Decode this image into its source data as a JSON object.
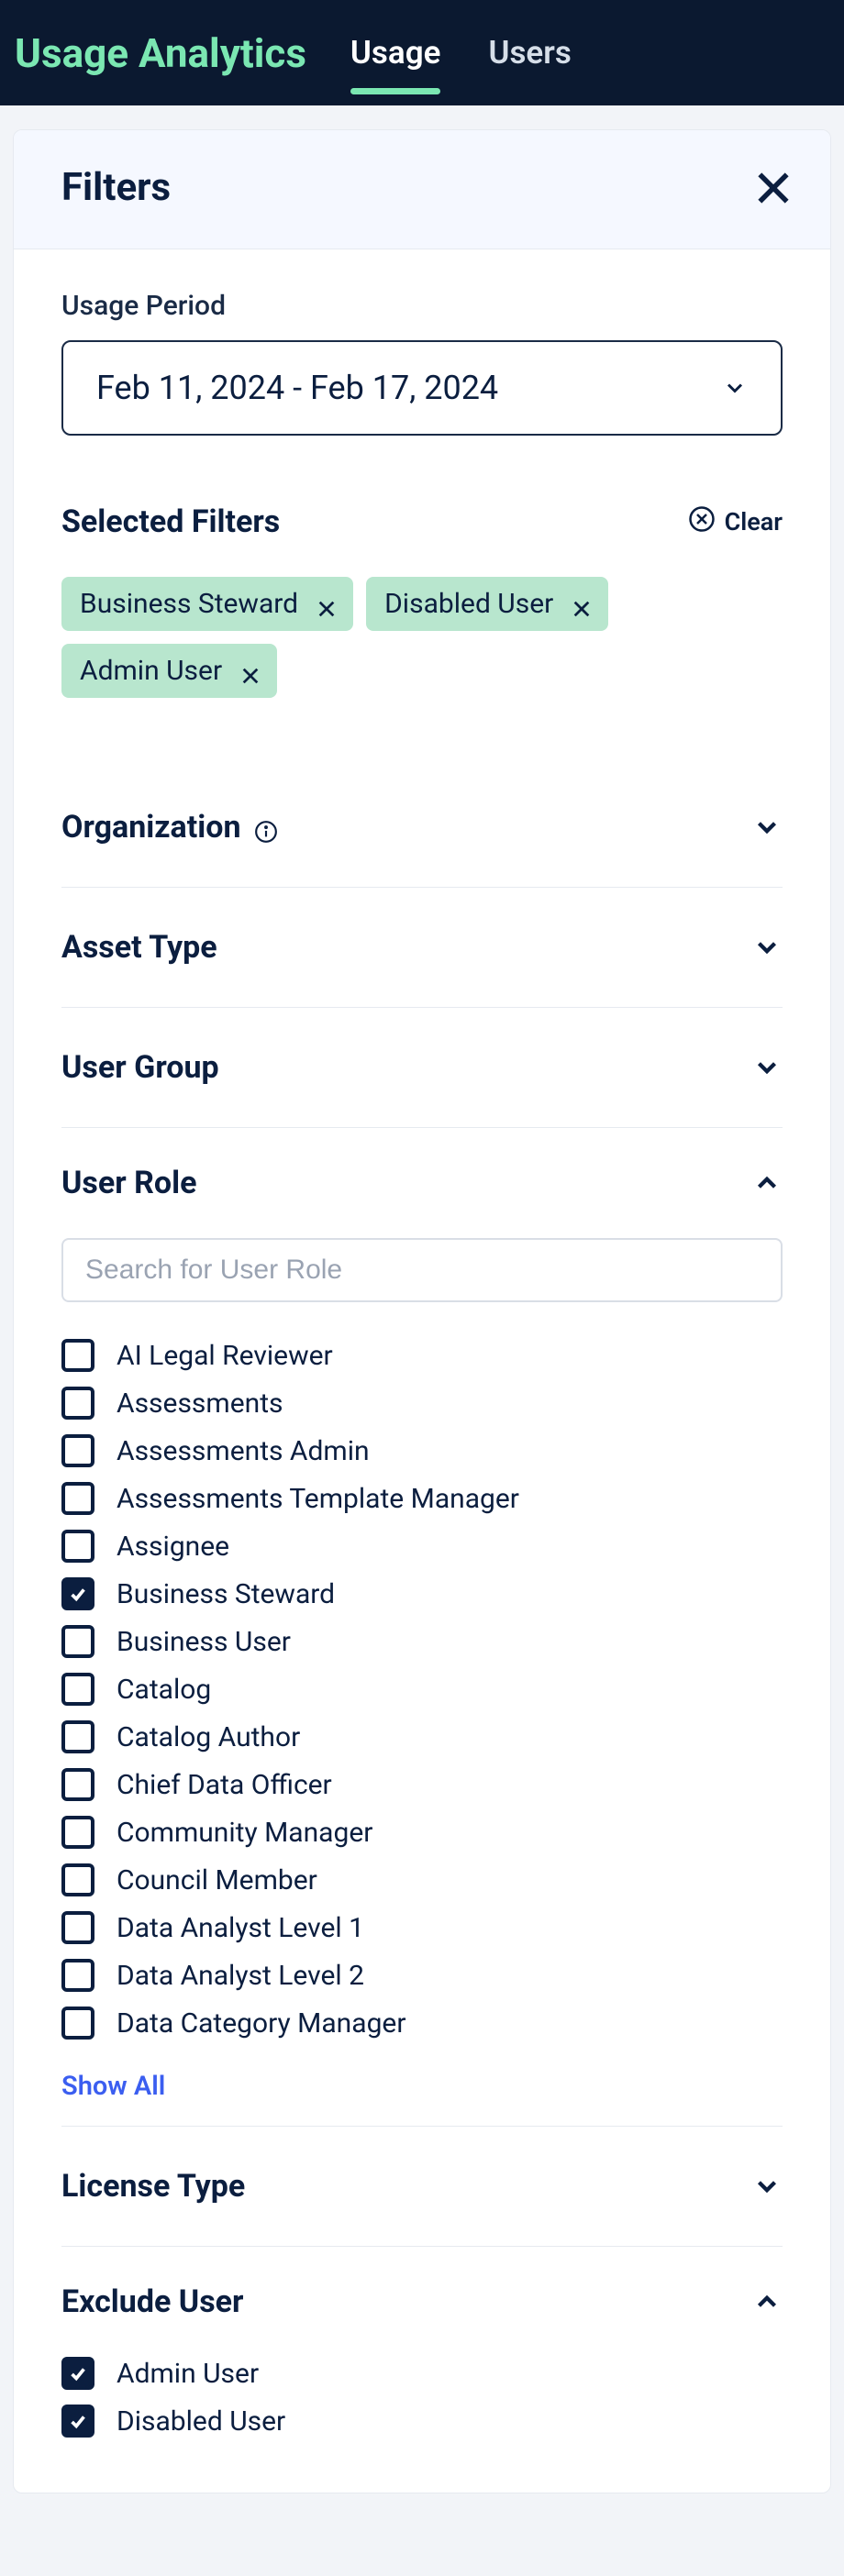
{
  "topnav": {
    "title": "Usage Analytics",
    "tabs": [
      {
        "label": "Usage",
        "active": true
      },
      {
        "label": "Users",
        "active": false
      }
    ]
  },
  "panel": {
    "title": "Filters"
  },
  "usage_period": {
    "label": "Usage Period",
    "value": "Feb 11, 2024 - Feb 17, 2024"
  },
  "selected_filters": {
    "title": "Selected Filters",
    "clear_label": "Clear",
    "chips": [
      {
        "label": "Business Steward"
      },
      {
        "label": "Disabled User"
      },
      {
        "label": "Admin User"
      }
    ]
  },
  "sections": {
    "organization": {
      "title": "Organization",
      "expanded": false,
      "has_info": true
    },
    "asset_type": {
      "title": "Asset Type",
      "expanded": false
    },
    "user_group": {
      "title": "User Group",
      "expanded": false
    },
    "user_role": {
      "title": "User Role",
      "expanded": true,
      "search_placeholder": "Search for User Role",
      "show_all_label": "Show All",
      "items": [
        {
          "label": "AI Legal Reviewer",
          "checked": false
        },
        {
          "label": "Assessments",
          "checked": false
        },
        {
          "label": "Assessments Admin",
          "checked": false
        },
        {
          "label": "Assessments Template Manager",
          "checked": false
        },
        {
          "label": "Assignee",
          "checked": false
        },
        {
          "label": "Business Steward",
          "checked": true
        },
        {
          "label": "Business User",
          "checked": false
        },
        {
          "label": "Catalog",
          "checked": false
        },
        {
          "label": "Catalog Author",
          "checked": false
        },
        {
          "label": "Chief Data Officer",
          "checked": false
        },
        {
          "label": "Community Manager",
          "checked": false
        },
        {
          "label": "Council Member",
          "checked": false
        },
        {
          "label": "Data Analyst Level 1",
          "checked": false
        },
        {
          "label": "Data Analyst Level 2",
          "checked": false
        },
        {
          "label": "Data Category Manager",
          "checked": false
        }
      ]
    },
    "license_type": {
      "title": "License Type",
      "expanded": false
    },
    "exclude_user": {
      "title": "Exclude User",
      "expanded": true,
      "items": [
        {
          "label": "Admin User",
          "checked": true
        },
        {
          "label": "Disabled User",
          "checked": true
        }
      ]
    }
  }
}
